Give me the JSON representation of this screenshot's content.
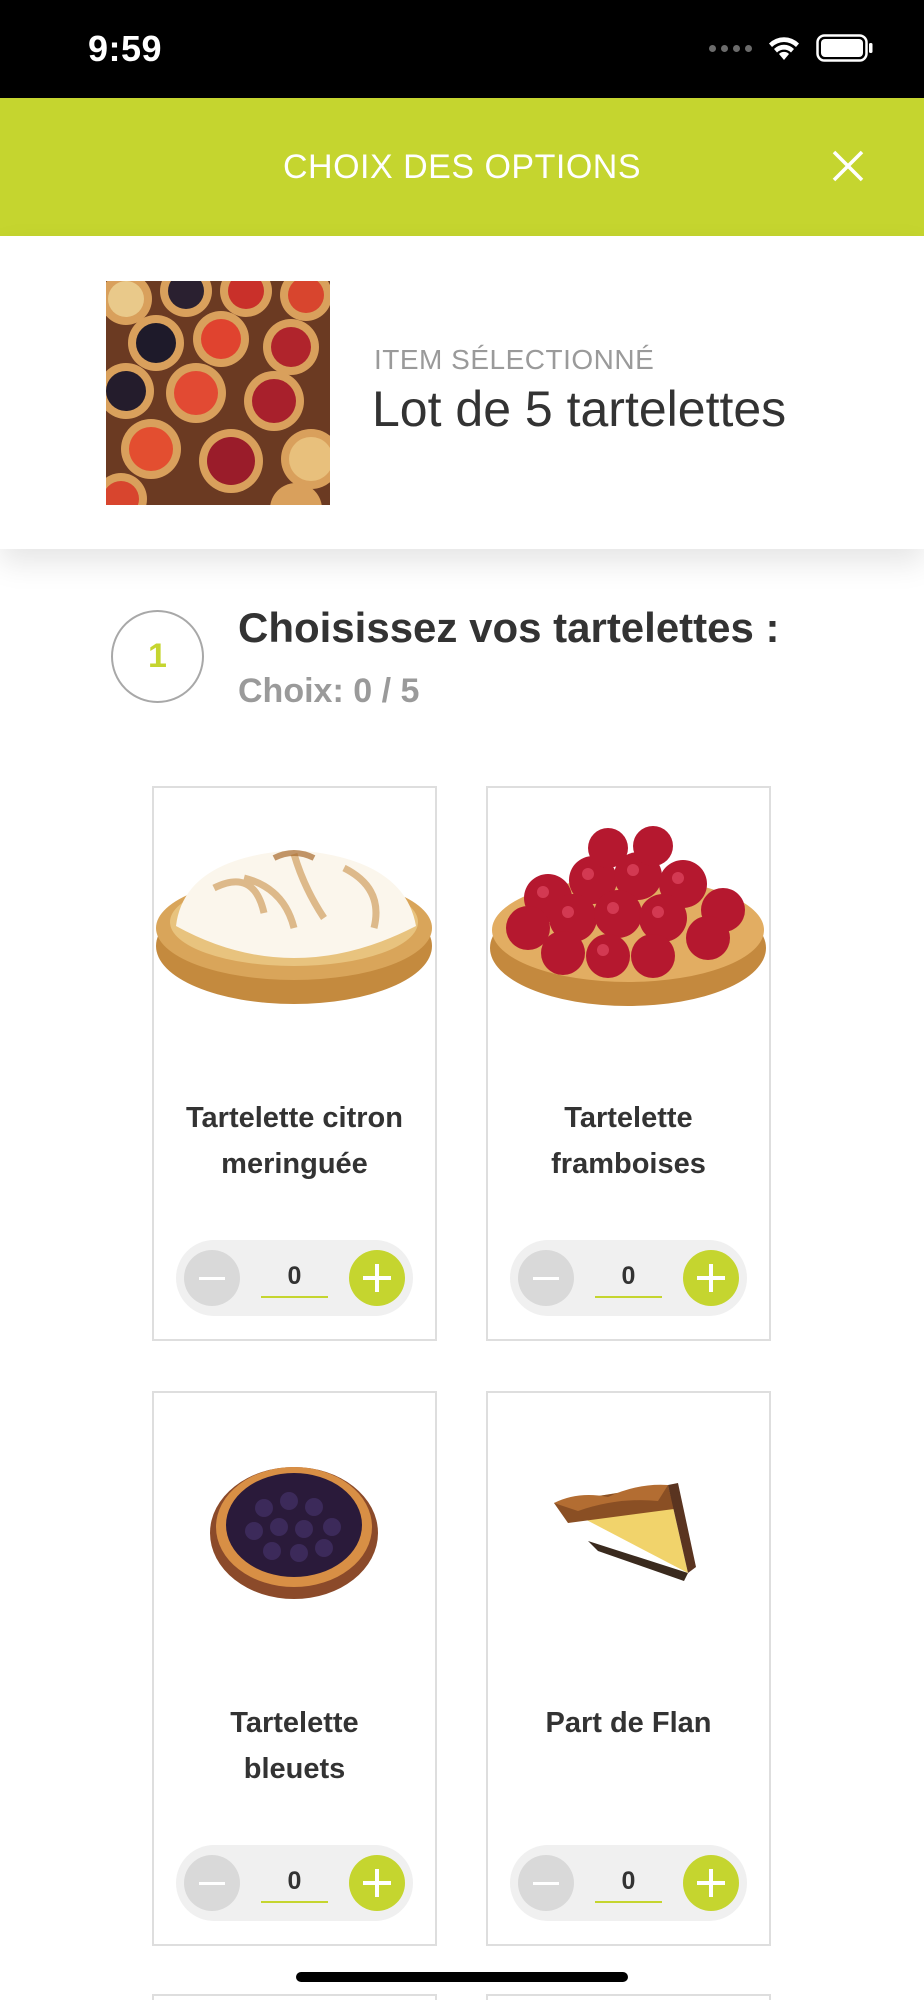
{
  "status_bar": {
    "time": "9:59"
  },
  "header": {
    "title": "CHOIX DES OPTIONS",
    "close_icon": "close-icon"
  },
  "selected_item": {
    "caption": "ITEM SÉLECTIONNÉ",
    "name": "Lot de 5 tartelettes"
  },
  "step": {
    "number": "1",
    "title": "Choisissez vos tartelettes :",
    "counter": "Choix: 0 / 5"
  },
  "products": [
    {
      "name_line1": "Tartelette citron",
      "name_line2": "meringuée",
      "quantity": "0"
    },
    {
      "name_line1": "Tartelette",
      "name_line2": "framboises",
      "quantity": "0"
    },
    {
      "name_line1": "Tartelette",
      "name_line2": "bleuets",
      "quantity": "0"
    },
    {
      "name_line1": "Part de Flan",
      "name_line2": "",
      "quantity": "0"
    }
  ],
  "colors": {
    "accent": "#c5d52f",
    "text": "#333333",
    "muted": "#9a9a9a"
  }
}
